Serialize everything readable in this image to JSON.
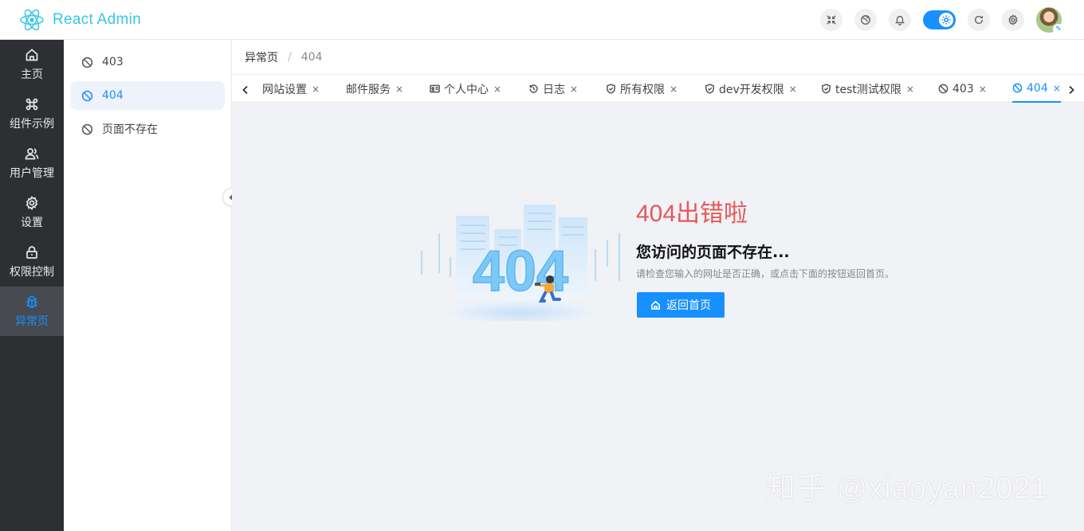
{
  "app": {
    "title": "React Admin",
    "accent": "#1890ff",
    "logo_color": "#36c6e6"
  },
  "header": {
    "actions": [
      {
        "icon": "fullscreen-icon"
      },
      {
        "icon": "globe-icon"
      },
      {
        "icon": "bell-icon"
      },
      {
        "icon": "theme-toggle",
        "state": "on"
      },
      {
        "icon": "refresh-icon"
      },
      {
        "icon": "gear-icon"
      },
      {
        "icon": "user-avatar"
      }
    ]
  },
  "nav": {
    "items": [
      {
        "label": "主页",
        "icon": "home-icon"
      },
      {
        "label": "组件示例",
        "icon": "command-icon"
      },
      {
        "label": "用户管理",
        "icon": "users-icon"
      },
      {
        "label": "设置",
        "icon": "gear-icon"
      },
      {
        "label": "权限控制",
        "icon": "lock-icon"
      },
      {
        "label": "异常页",
        "icon": "bug-icon",
        "active": true
      }
    ]
  },
  "submenu": {
    "items": [
      {
        "label": "403",
        "icon": "ban-icon"
      },
      {
        "label": "404",
        "icon": "ban-icon",
        "active": true
      },
      {
        "label": "页面不存在",
        "icon": "ban-icon"
      }
    ]
  },
  "breadcrumb": {
    "items": [
      "异常页",
      "404"
    ],
    "separator": "/"
  },
  "tabs": {
    "items": [
      {
        "label": "网站设置",
        "icon": ""
      },
      {
        "label": "邮件服务",
        "icon": ""
      },
      {
        "label": "个人中心",
        "icon": "id-card-icon"
      },
      {
        "label": "日志",
        "icon": "history-icon"
      },
      {
        "label": "所有权限",
        "icon": "shield-icon"
      },
      {
        "label": "dev开发权限",
        "icon": "shield-icon"
      },
      {
        "label": "test测试权限",
        "icon": "shield-icon"
      },
      {
        "label": "403",
        "icon": "ban-icon"
      },
      {
        "label": "404",
        "icon": "ban-icon",
        "active": true
      }
    ],
    "close_glyph": "×"
  },
  "error": {
    "illustration_text": "404",
    "title": "404出错啦",
    "subtitle": "您访问的页面不存在...",
    "description": "请检查您输入的网址是否正确，或点击下面的按钮返回首页。",
    "button_label": "返回首页",
    "title_color": "#e3595b"
  },
  "watermark": "知乎 @xiaoyan2021"
}
